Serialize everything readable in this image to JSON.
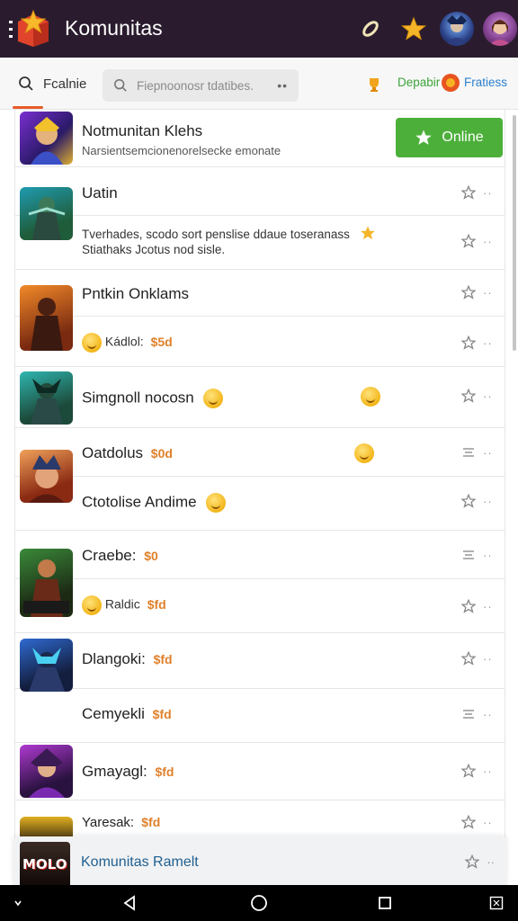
{
  "app": {
    "title": "Komunitas",
    "accent_color": "#4caf3a",
    "header_color": "#2a1c2e"
  },
  "filters": {
    "tab_label": "Fcalnie",
    "search_placeholder": "Fiepnoonosr tdatibes.",
    "search_more": "••",
    "right_label_1": "Depabir",
    "right_label_2": "Fratiess"
  },
  "rows": [
    {
      "title": "Notmunitan Klehs",
      "subtitle": "Narsientsemcionenorelsecke emonate",
      "action": "Online"
    },
    {
      "title": "Uatin",
      "subtitle_1": "Tverhades, scodo sort penslise ddaue toseranass",
      "subtitle_2": "Stiathaks Jcotus nod sisle."
    },
    {
      "title": "Pntkin Onklams",
      "subtitle": "Kádlol:",
      "price": "$5d"
    },
    {
      "title": "Simgnoll nocosn"
    },
    {
      "title": "Oatdolus",
      "price": "$0d"
    },
    {
      "title": "Ctotolise Andime"
    },
    {
      "title": "Craebe:",
      "price": "$0"
    },
    {
      "title": "Raldic",
      "price": "$fd"
    },
    {
      "title": "Dlangoki:",
      "price": "$fd"
    },
    {
      "title": "Cemyekli",
      "price": "$fd"
    },
    {
      "title": "Gmayagl:",
      "price": "$fd"
    },
    {
      "title": "Yaresak:",
      "price": "$fd"
    }
  ],
  "footer_card": {
    "title": "Komunitas Ramelt",
    "badge": "MOLO"
  },
  "icons": {
    "menu": "menu-icon",
    "logo": "star-box-logo",
    "pin": "paperclip-icon",
    "star": "star-icon",
    "search": "search-icon",
    "more": "more-dots-icon",
    "back": "back-icon",
    "home": "home-icon",
    "recents": "recents-icon"
  }
}
